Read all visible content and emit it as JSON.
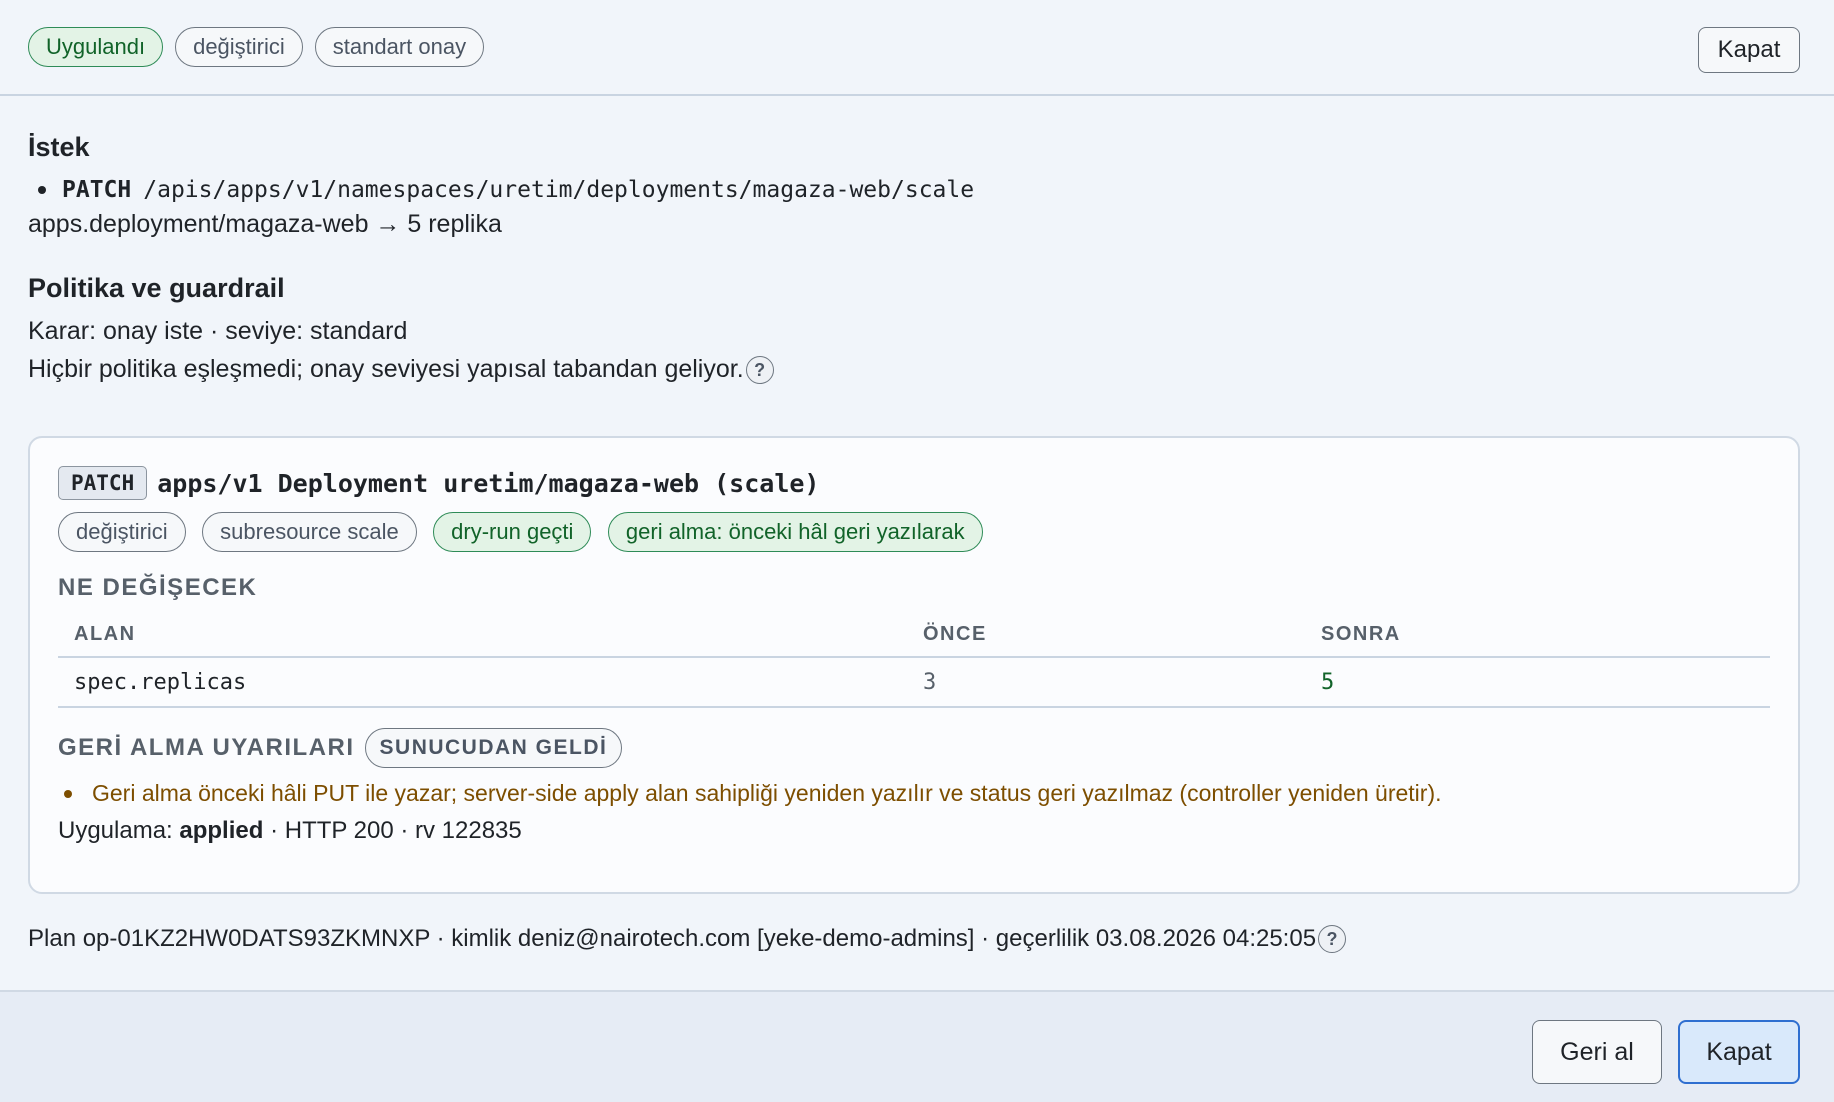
{
  "header": {
    "badges": [
      "Uygulandı",
      "değiştirici",
      "standart onay"
    ],
    "close_label": "Kapat"
  },
  "request": {
    "title": "İstek",
    "method": "PATCH",
    "path": "/apis/apps/v1/namespaces/uretim/deployments/magaza-web/scale",
    "summary": "apps.deployment/magaza-web → 5 replika"
  },
  "policy": {
    "title": "Politika ve guardrail",
    "decision": "Karar: onay iste · seviye: standard",
    "note": "Hiçbir politika eşleşmedi; onay seviyesi yapısal tabandan geliyor.",
    "help": "?"
  },
  "operation": {
    "verb": "PATCH",
    "target": "apps/v1 Deployment uretim/magaza-web (scale)",
    "tags": [
      {
        "label": "değiştirici",
        "tone": "neutral"
      },
      {
        "label": "subresource scale",
        "tone": "neutral"
      },
      {
        "label": "dry-run geçti",
        "tone": "green"
      },
      {
        "label": "geri alma: önceki hâl geri yazılarak",
        "tone": "green"
      }
    ],
    "changes_title": "NE DEĞİŞECEK",
    "columns": [
      "ALAN",
      "ÖNCE",
      "SONRA"
    ],
    "rows": [
      {
        "field": "spec.replicas",
        "before": "3",
        "after": "5"
      }
    ],
    "rollback_title": "GERİ ALMA UYARILARI",
    "rollback_badge": "SUNUCUDAN GELDİ",
    "rollback_warnings": [
      "Geri alma önceki hâli PUT ile yazar; server-side apply alan sahipliği yeniden yazılır ve status geri yazılmaz (controller yeniden üretir)."
    ],
    "execution_prefix": "Uygulama:",
    "execution_status": "applied",
    "execution_suffix": " · HTTP 200 · rv 122835"
  },
  "plan_line": "Plan op-01KZ2HW0DATS93ZKMNXP · kimlik deniz@nairotech.com [yeke-demo-admins] · geçerlilik 03.08.2026 04:25:05",
  "footer": {
    "undo_label": "Geri al",
    "close_label": "Kapat"
  },
  "colors": {
    "success": "#116329",
    "warning": "#7d4e00",
    "primary_button_bg": "#d9e9fb",
    "primary_button_border": "#2f6fd0"
  }
}
